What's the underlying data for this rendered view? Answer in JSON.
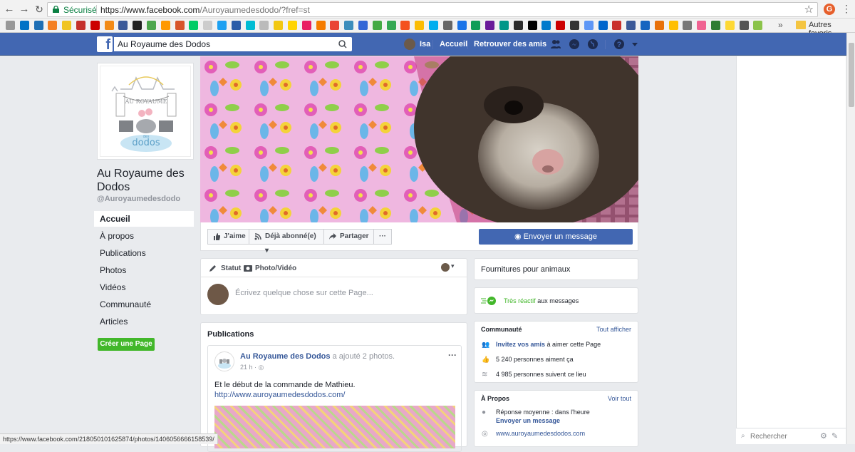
{
  "browser": {
    "secure_label": "Sécurisé",
    "url_host": "https://www.facebook.com",
    "url_path": "/Auroyaumedesdodo/?fref=st",
    "bookmarks_more": "»",
    "bookmarks_folder": "Autres favoris",
    "status_url": "https://www.facebook.com/218050101625874/photos/1406056666158539/"
  },
  "fbbar": {
    "search_value": "Au Royaume des Dodos",
    "user_name": "Isa",
    "home": "Accueil",
    "find_friends": "Retrouver des amis"
  },
  "page": {
    "name": "Au Royaume des Dodos",
    "username": "@Auroyaumedesdodo",
    "nav": [
      "Accueil",
      "À propos",
      "Publications",
      "Photos",
      "Vidéos",
      "Communauté",
      "Articles"
    ],
    "create_page": "Créer une Page"
  },
  "actions": {
    "like": "J'aime",
    "subscribed": "Déjà abonné(e)",
    "share": "Partager",
    "more": "···",
    "send_message": "Envoyer un message"
  },
  "composer": {
    "tab_status": "Statut",
    "tab_photo": "Photo/Vidéo",
    "placeholder": "Écrivez quelque chose sur cette Page..."
  },
  "publications": {
    "title": "Publications",
    "post": {
      "author": "Au Royaume des Dodos",
      "action": "a ajouté 2 photos.",
      "time": "21 h ·",
      "text": "Et le début de la commande de Mathieu.",
      "link": "http://www.auroyaumedesdodos.com/"
    }
  },
  "sidebar": {
    "category": "Fournitures pour animaux",
    "responsive_strong": "Très réactif",
    "responsive_rest": "aux messages",
    "community_title": "Communauté",
    "community_all": "Tout afficher",
    "invite_strong": "Invitez vos amis",
    "invite_rest": "à aimer cette Page",
    "likes": "5 240 personnes aiment ça",
    "follows": "4 985 personnes suivent ce lieu",
    "about_title": "À Propos",
    "about_all": "Voir tout",
    "response_time": "Réponse moyenne : dans l'heure",
    "send_message": "Envoyer un message",
    "website": "www.auroyaumedesdodos.com"
  },
  "chat": {
    "search_placeholder": "Rechercher"
  },
  "colors": {
    "fb_blue": "#4267b2",
    "link": "#365899",
    "green": "#42b72a"
  }
}
